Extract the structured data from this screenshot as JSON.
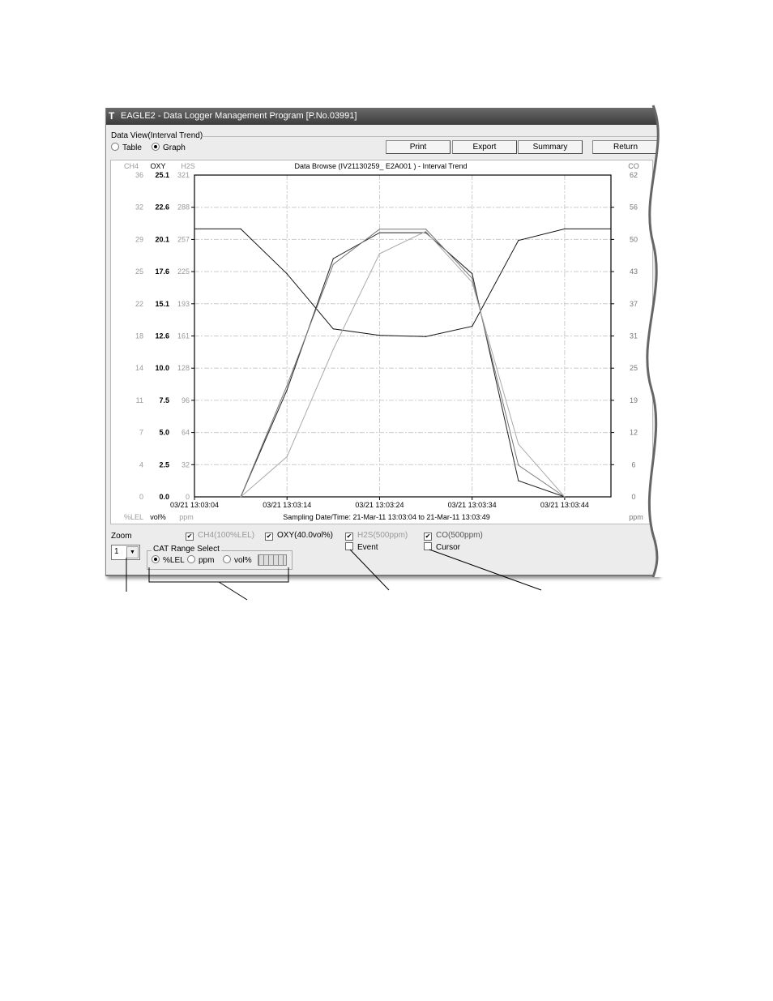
{
  "window": {
    "title": "EAGLE2  - Data Logger Management Program [P.No.03991]",
    "logo_icon": "T"
  },
  "view": {
    "group_label": "Data View(Interval Trend)",
    "radio_table": "Table",
    "radio_graph": "Graph",
    "selected": "Graph"
  },
  "toolbar": {
    "print": "Print",
    "export": "Export",
    "summary": "Summary",
    "return": "Return"
  },
  "chart_data": {
    "type": "line",
    "title": "Data Browse (IV21130259_     E2A001     ) - Interval Trend",
    "xlabel": "Sampling Date/Time: 21-Mar-11 13:03:04 to 21-Mar-11 13:03:49",
    "x_tick_labels": [
      "03/21 13:03:04",
      "03/21 13:03:14",
      "03/21 13:03:24",
      "03/21 13:03:34",
      "03/21 13:03:44"
    ],
    "x": [
      "13:03:04",
      "13:03:09",
      "13:03:14",
      "13:03:19",
      "13:03:24",
      "13:03:29",
      "13:03:34",
      "13:03:39",
      "13:03:44",
      "13:03:49"
    ],
    "xlim": [
      "13:03:04",
      "13:03:49"
    ],
    "grid": true,
    "axes": {
      "ch4": {
        "name": "CH4",
        "unit": "%LEL",
        "max": 36,
        "ticks": [
          "0",
          "4",
          "7",
          "11",
          "14",
          "18",
          "22",
          "25",
          "29",
          "32",
          "36"
        ]
      },
      "oxy": {
        "name": "OXY",
        "unit": "vol%",
        "max": 25.1,
        "ticks": [
          "0.0",
          "2.5",
          "5.0",
          "7.5",
          "10.0",
          "12.6",
          "15.1",
          "17.6",
          "20.1",
          "22.6",
          "25.1"
        ]
      },
      "h2s": {
        "name": "H2S",
        "unit": "ppm",
        "max": 321,
        "ticks": [
          "0",
          "32",
          "64",
          "96",
          "128",
          "161",
          "193",
          "225",
          "257",
          "288",
          "321"
        ]
      },
      "co": {
        "name": "CO",
        "unit": "ppm",
        "max": 62,
        "ticks": [
          "0",
          "6",
          "12",
          "19",
          "25",
          "31",
          "37",
          "43",
          "50",
          "56",
          "62"
        ]
      }
    },
    "series": [
      {
        "axis": "oxy",
        "color": "#111111",
        "values": [
          20.9,
          20.9,
          17.4,
          13.1,
          12.6,
          12.5,
          13.3,
          20.0,
          20.9,
          20.9
        ]
      },
      {
        "axis": "co",
        "color": "#222222",
        "values": [
          null,
          0,
          20.6,
          45.9,
          50.9,
          50.9,
          43.0,
          3.1,
          0,
          null
        ]
      },
      {
        "axis": "h2s",
        "color": "#777777",
        "values": [
          null,
          0,
          111,
          232,
          267,
          267,
          218,
          31.5,
          0,
          null
        ]
      },
      {
        "axis": "ch4",
        "color": "#aaaaaa",
        "values": [
          null,
          0,
          4.5,
          16.5,
          27.2,
          29.7,
          24.0,
          5.9,
          0,
          null
        ]
      }
    ]
  },
  "controls": {
    "zoom_label": "Zoom",
    "zoom_value": "1",
    "cat_range_label": "CAT Range Select",
    "cat_lel": "%LEL",
    "cat_ppm": "ppm",
    "cat_vol": "vol%",
    "chk_ch4": "CH4(100%LEL)",
    "chk_oxy": "OXY(40.0vol%)",
    "chk_h2s": "H2S(500ppm)",
    "chk_co": "CO(500ppm)",
    "chk_event": "Event",
    "chk_cursor": "Cursor",
    "check_mark": "✔"
  }
}
